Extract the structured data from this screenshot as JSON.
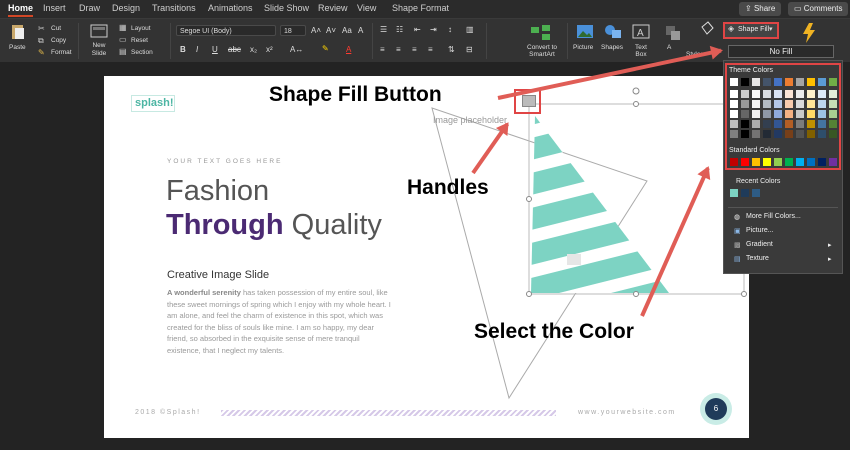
{
  "tabs": [
    "Home",
    "Insert",
    "Draw",
    "Design",
    "Transitions",
    "Animations",
    "Slide Show",
    "Review",
    "View",
    "Shape Format"
  ],
  "share_label": "Share",
  "comments_label": "Comments",
  "ribbon": {
    "paste": "Paste",
    "cut": "Cut",
    "copy": "Copy",
    "format": "Format",
    "new_slide": "New Slide",
    "layout": "Layout",
    "reset": "Reset",
    "section": "Section",
    "font_name": "Segoe UI (Body)",
    "font_size": "18",
    "convert_smartart": "Convert to SmartArt",
    "picture": "Picture",
    "shapes": "Shapes",
    "text_box": "Text Box",
    "arrange": "A",
    "quick_styles": "Styles",
    "shape_fill": "Shape Fill"
  },
  "slide": {
    "logo": "splash!",
    "kicker": "YOUR TEXT GOES HERE",
    "title_line1": "Fashion",
    "title_bold": "Through",
    "title_rest": "Quality",
    "subtitle": "Creative Image Slide",
    "body_bold": "A wonderful serenity",
    "body_rest": " has taken possession of my entire soul, like these sweet mornings of spring which I enjoy with my whole heart. I am alone, and feel the charm of existence in this spot, which was created for the bliss of souls like mine. I am so happy, my dear friend, so absorbed in the exquisite sense of mere tranquil existence, that I neglect my talents.",
    "placeholder": "Image placeholder",
    "footer_left": "2018 ©Splash!",
    "footer_right": "www.yourwebsite.com",
    "page_number": "6"
  },
  "annotations": {
    "shape_fill": "Shape Fill Button",
    "handles": "Handles",
    "select_color": "Select the Color"
  },
  "menu": {
    "no_fill": "No Fill",
    "theme_colors": "Theme Colors",
    "standard_colors": "Standard Colors",
    "recent_colors": "Recent Colors",
    "more_colors": "More Fill Colors...",
    "picture": "Picture...",
    "gradient": "Gradient",
    "texture": "Texture"
  },
  "colors": {
    "accent_red": "#e04545",
    "teal": "#7dd3c3",
    "purple": "#4b2a73",
    "theme_top": [
      "#ffffff",
      "#000000",
      "#e7e6e6",
      "#44546a",
      "#4472c4",
      "#ed7d31",
      "#a5a5a5",
      "#ffc000",
      "#5b9bd5",
      "#70ad47"
    ],
    "standard": [
      "#c00000",
      "#ff0000",
      "#ffc000",
      "#ffff00",
      "#92d050",
      "#00b050",
      "#00b0f0",
      "#0070c0",
      "#002060",
      "#7030a0"
    ],
    "recent": [
      "#7dd3c3",
      "#1f3b5a",
      "#2e5c85"
    ]
  }
}
